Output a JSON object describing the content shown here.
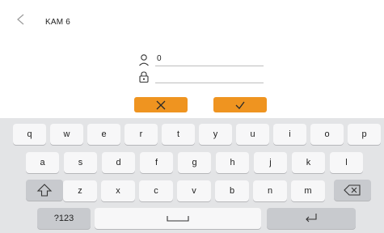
{
  "header": {
    "title": "KAM 6",
    "back_icon": "chevron-left-icon"
  },
  "form": {
    "user_icon": "user-icon",
    "user_value": "0",
    "password_icon": "lock-icon",
    "password_value": ""
  },
  "buttons": {
    "cancel_icon": "close-icon",
    "confirm_icon": "check-icon",
    "color": "#ef9420"
  },
  "keyboard": {
    "row1": [
      "q",
      "w",
      "e",
      "r",
      "t",
      "y",
      "u",
      "i",
      "o",
      "p"
    ],
    "row2": [
      "a",
      "s",
      "d",
      "f",
      "g",
      "h",
      "j",
      "k",
      "l"
    ],
    "row3": [
      "z",
      "x",
      "c",
      "v",
      "b",
      "n",
      "m"
    ],
    "symbols_label": "?123",
    "shift_icon": "shift-icon",
    "backspace_icon": "backspace-icon",
    "space_icon": "space-icon",
    "enter_icon": "enter-icon"
  }
}
